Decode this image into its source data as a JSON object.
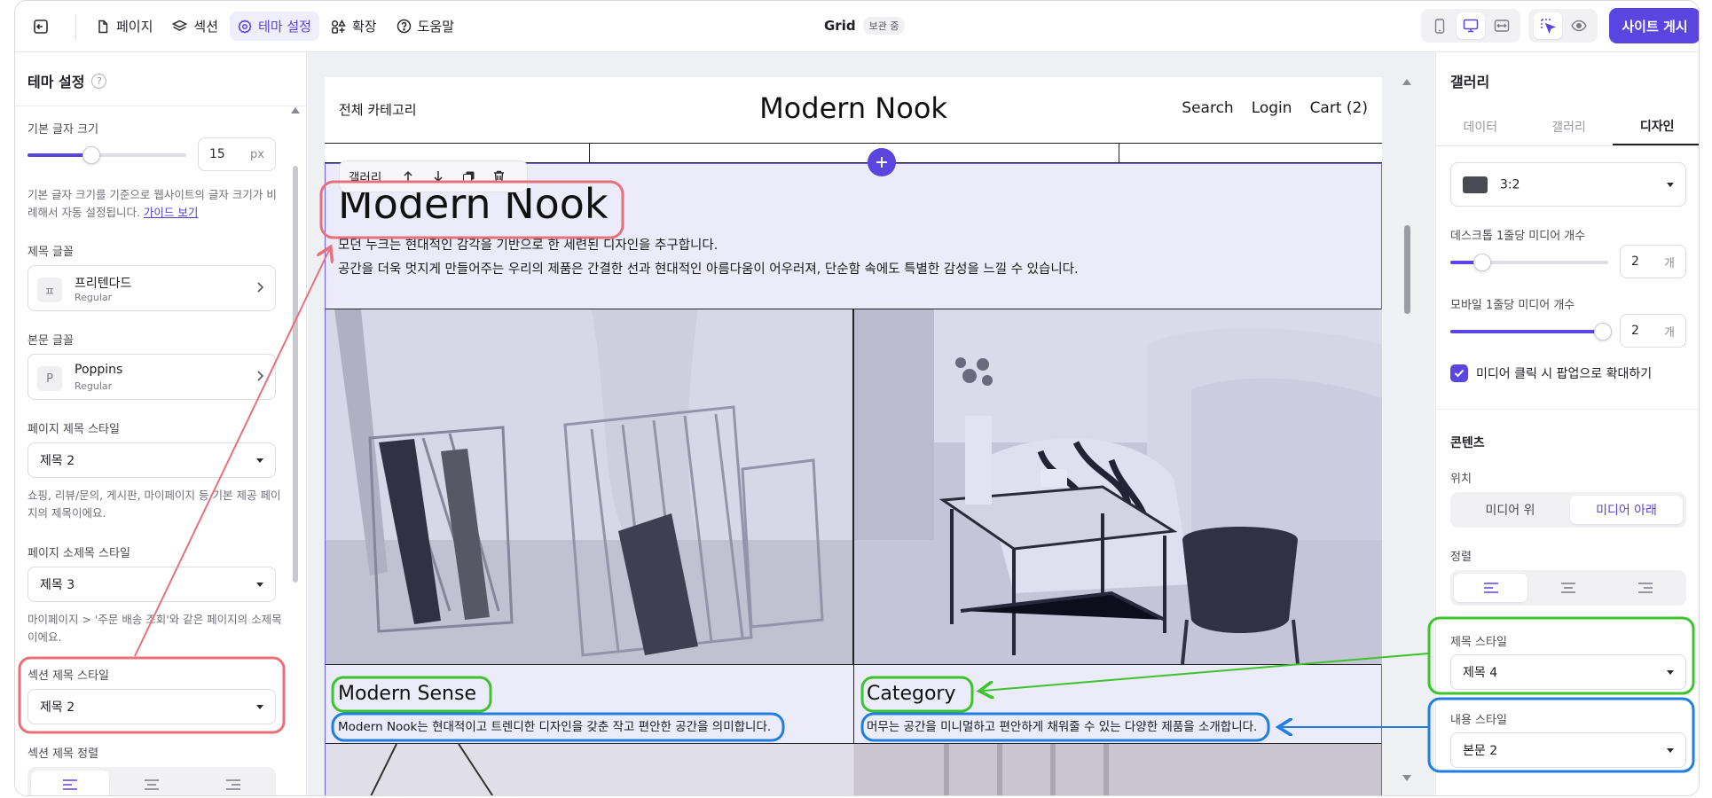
{
  "topbar": {
    "nav": [
      {
        "label": "페이지",
        "icon": "file-icon"
      },
      {
        "label": "섹션",
        "icon": "layers-icon"
      },
      {
        "label": "테마 설정",
        "icon": "gear-icon"
      },
      {
        "label": "확장",
        "icon": "extension-icon"
      },
      {
        "label": "도움말",
        "icon": "help-icon"
      }
    ],
    "site_name": "Grid",
    "status_badge": "보관 중",
    "publish_label": "사이트 게시"
  },
  "left_panel": {
    "title": "테마 설정",
    "base_font": {
      "label": "기본 글자 크기",
      "value": "15",
      "unit": "px",
      "level_fraction": 0.4
    },
    "base_font_help": "기본 글자 크기를 기준으로 웹사이트의 글자 크기가 비례해서 자동 설정됩니다.",
    "guide_link": "가이드 보기",
    "title_font": {
      "label": "제목 글꼴",
      "glyph": "ㅍ",
      "name": "프리텐다드",
      "weight": "Regular"
    },
    "body_font": {
      "label": "본문 글꼴",
      "glyph": "P",
      "name": "Poppins",
      "weight": "Regular"
    },
    "page_title_style": {
      "label": "페이지 제목 스타일",
      "value": "제목 2",
      "help": "쇼핑, 리뷰/문의, 게시판, 마이페이지 등 기본 제공 페이지의 제목이에요."
    },
    "page_subtitle_style": {
      "label": "페이지 소제목 스타일",
      "value": "제목 3",
      "help": "마이페이지 > '주문 배송 조회'와 같은 페이지의 소제목이에요."
    },
    "section_title_style": {
      "label": "섹션 제목 스타일",
      "value": "제목 2"
    },
    "section_title_align": {
      "label": "섹션 제목 정렬"
    }
  },
  "site": {
    "header_left": "전체 카테고리",
    "logo": "Modern Nook",
    "nav": [
      "Search",
      "Login",
      "Cart (2)"
    ],
    "section_toolbar_label": "갤러리",
    "section_title": "Modern Nook",
    "section_desc_1": "모던 누크는 현대적인 감각을 기반으로 한 세련된 디자인을 추구합니다.",
    "section_desc_2": "공간을 더욱 멋지게 만들어주는 우리의 제품은 간결한 선과 현대적인 아름다움이 어우러져, 단순함 속에도 특별한 감성을 느낄 수 있습니다.",
    "items": [
      {
        "title": "Modern Sense",
        "text": "Modern Nook는 현대적이고 트렌디한 디자인을 갖춘 작고 편안한 공간을 의미합니다."
      },
      {
        "title": "Category",
        "text": "머무는 공간을 미니멀하고 편안하게 채워줄 수 있는 다양한 제품을 소개합니다."
      }
    ]
  },
  "right_panel": {
    "title": "갤러리",
    "tabs": [
      "데이터",
      "갤러리",
      "디자인"
    ],
    "ratio_value": "3:2",
    "desktop_per_row": {
      "label": "데스크톱 1줄당 미디어 개수",
      "value": "2",
      "unit": "개",
      "level_fraction": 0.2
    },
    "mobile_per_row": {
      "label": "모바일 1줄당 미디어 개수",
      "value": "2",
      "unit": "개",
      "level_fraction": 1.0
    },
    "popup_checkbox": "미디어 클릭 시 팝업으로 확대하기",
    "content_section": "콘텐츠",
    "position": {
      "label": "위치",
      "options": [
        "미디어 위",
        "미디어 아래"
      ],
      "selected": "미디어 아래"
    },
    "align_label": "정렬",
    "title_style": {
      "label": "제목 스타일",
      "value": "제목 4"
    },
    "content_style": {
      "label": "내용 스타일",
      "value": "본문 2"
    }
  },
  "colors": {
    "accent": "#5b45e0",
    "annotation_red": "#e8707a",
    "annotation_green": "#3cc42c",
    "annotation_blue": "#1f7fe0"
  }
}
